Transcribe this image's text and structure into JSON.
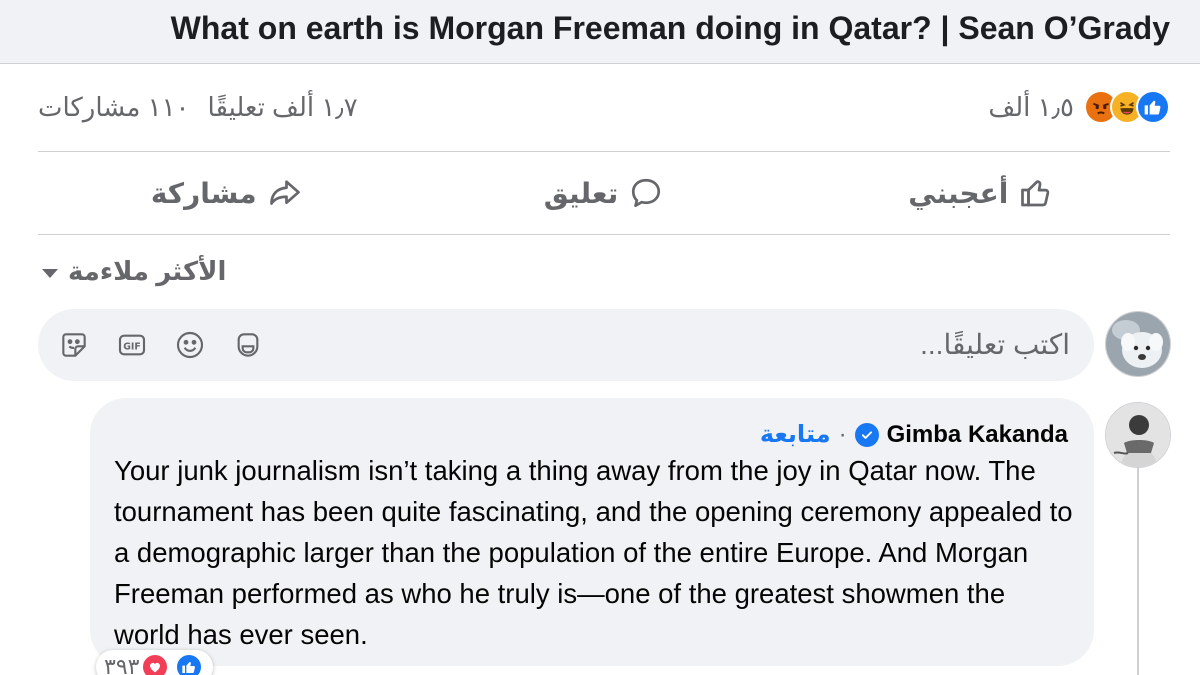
{
  "post": {
    "title": "What on earth is Morgan Freeman doing in Qatar? | Sean O’Grady"
  },
  "stats": {
    "reactions_count": "١٫٥ ألف",
    "reaction_icons": [
      "like-icon",
      "haha-icon",
      "angry-icon"
    ],
    "comments_count": "١٫٧ ألف تعليقًا",
    "shares_count": "١١٠ مشاركات"
  },
  "actions": {
    "like_label": "أعجبني",
    "comment_label": "تعليق",
    "share_label": "مشاركة"
  },
  "sort": {
    "label": "الأكثر ملاءمة"
  },
  "composer": {
    "placeholder": "اكتب تعليقًا...",
    "tools": [
      "sticker-icon",
      "gif-icon",
      "emoji-icon",
      "avatar-sticker-icon"
    ]
  },
  "comment": {
    "author": "Gimba Kakanda",
    "separator": "·",
    "follow_label": "متابعة",
    "text": "Your junk journalism isn’t taking a thing away from the joy in Qatar now. The tournament has been quite fascinating, and the opening ceremony appealed to a demographic larger than the population of the entire Europe. And Morgan Freeman performed as who he truly is—one of the greatest showmen the world has ever seen.",
    "reaction_count": "٣٩٣",
    "reaction_icons": [
      "like-icon",
      "love-icon"
    ]
  },
  "colors": {
    "accent": "#1877f2",
    "muted_text": "#65676b",
    "bubble_bg": "#f0f2f5",
    "divider": "#ced0d4"
  }
}
